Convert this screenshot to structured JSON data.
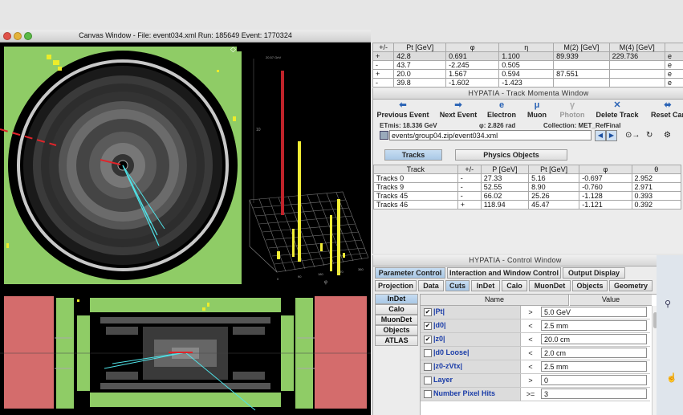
{
  "canvas_window": {
    "title": "Canvas Window -  File: event034.xml  Run: 185649  Event: 1770324",
    "lego": {
      "top_label": "20.57 GeV",
      "scale_tick": "10",
      "axis_ticks": [
        "0",
        "90",
        "180",
        "270",
        "360"
      ],
      "axis_symbol": "φ"
    }
  },
  "particles_table": {
    "headers": [
      "+/-",
      "Pt [GeV]",
      "φ",
      "η",
      "M(2) [GeV]",
      "M(4) [GeV]",
      ""
    ],
    "rows": [
      [
        "+",
        "42.8",
        "0.691",
        "1.100",
        "89.939",
        "229.736",
        "e"
      ],
      [
        "-",
        "43.7",
        "-2.245",
        "0.505",
        "",
        "",
        "e"
      ],
      [
        "+",
        "20.0",
        "1.567",
        "0.594",
        "87.551",
        "",
        "e"
      ],
      [
        "-",
        "39.8",
        "-1.602",
        "-1.423",
        "",
        "",
        "e"
      ]
    ]
  },
  "track_window": {
    "title": "HYPATIA - Track Momenta Window",
    "toolbar": [
      {
        "label": "Previous Event",
        "icon": "arrow-left-icon",
        "glyph": "⬅"
      },
      {
        "label": "Next Event",
        "icon": "arrow-right-icon",
        "glyph": "➡"
      },
      {
        "label": "Electron",
        "icon": "electron-icon",
        "glyph": "e"
      },
      {
        "label": "Muon",
        "icon": "muon-icon",
        "glyph": "μ"
      },
      {
        "label": "Photon",
        "icon": "photon-icon",
        "glyph": "γ"
      },
      {
        "label": "Delete Track",
        "icon": "delete-icon",
        "glyph": "✕"
      },
      {
        "label": "Reset Car",
        "icon": "reset-icon",
        "glyph": "⬌"
      }
    ],
    "info_etmis": "ETmis: 18.336 GeV",
    "info_phi": "φ: 2.826 rad",
    "info_collection": "Collection: MET_RefFinal",
    "file_path": "events/group04.zip/event034.xml",
    "tabs": [
      "Tracks",
      "Physics Objects"
    ],
    "tracks_headers": [
      "Track",
      "+/-",
      "P [GeV]",
      "Pt [GeV]",
      "φ",
      "θ"
    ],
    "tracks_rows": [
      [
        "Tracks 0",
        "-",
        "27.33",
        "5.16",
        "-0.697",
        "2.952"
      ],
      [
        "Tracks 9",
        "-",
        "52.55",
        "8.90",
        "-0.760",
        "2.971"
      ],
      [
        "Tracks 45",
        "-",
        "66.02",
        "25.26",
        "-1.128",
        "0.393"
      ],
      [
        "Tracks 46",
        "+",
        "118.94",
        "45.47",
        "-1.121",
        "0.392"
      ]
    ]
  },
  "control_window": {
    "title": "HYPATIA - Control Window",
    "top_tabs": [
      "Parameter Control",
      "Interaction and Window Control",
      "Output Display"
    ],
    "sub_tabs": [
      "Projection",
      "Data",
      "Cuts",
      "InDet",
      "Calo",
      "MuonDet",
      "Objects",
      "Geometry"
    ],
    "side_tabs": [
      "InDet",
      "Calo",
      "MuonDet",
      "Objects",
      "ATLAS"
    ],
    "col_name": "Name",
    "col_value": "Value",
    "cuts": [
      {
        "name": "|Pt|",
        "checked": true,
        "op": ">",
        "value": "5.0 GeV"
      },
      {
        "name": "|d0|",
        "checked": true,
        "op": "<",
        "value": "2.5 mm"
      },
      {
        "name": "|z0|",
        "checked": true,
        "op": "<",
        "value": "20.0 cm"
      },
      {
        "name": "|d0 Loose|",
        "checked": false,
        "op": "<",
        "value": "2.0 cm"
      },
      {
        "name": "|z0-zVtx|",
        "checked": false,
        "op": "<",
        "value": "2.5 mm"
      },
      {
        "name": "Layer",
        "checked": false,
        "op": ">",
        "value": "0"
      },
      {
        "name": "Number Pixel Hits",
        "checked": false,
        "op": ">=",
        "value": "3"
      }
    ],
    "check_glyph": "✔"
  }
}
